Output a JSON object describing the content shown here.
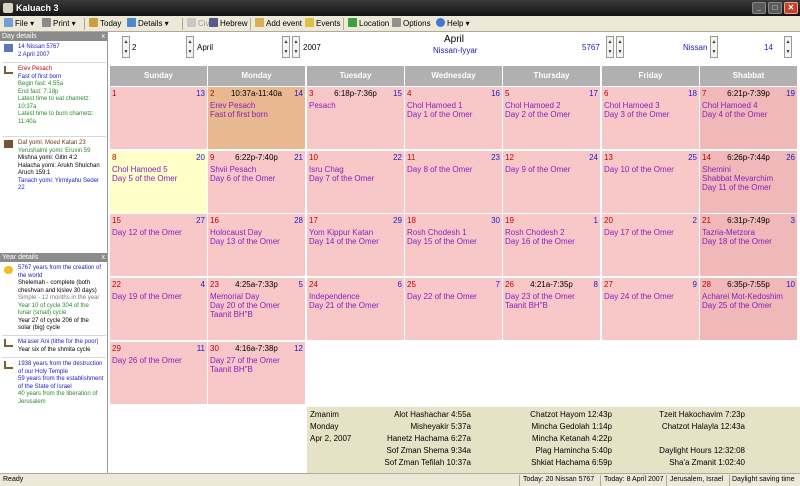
{
  "window": {
    "title": "Kaluach 3"
  },
  "toolbar": {
    "file": "File",
    "print": "Print",
    "today": "Today",
    "details": "Details",
    "civil": "Civil",
    "hebrew": "Hebrew",
    "add_event": "Add event",
    "events": "Events",
    "location": "Location",
    "options": "Options",
    "help": "Help"
  },
  "sidebar": {
    "day_header": "Day details",
    "year_header": "Year details",
    "close_glyph": "x",
    "date_lines": [
      "14 Nissan 5767",
      "2 April 2007"
    ],
    "erev_lines": [
      "Erev Pesach",
      "Fast of first born",
      "Begin fast: 4:55a",
      "End fast: 7:18p",
      "Latest time to eat chametz:",
      "10:37a",
      "Latest time to burn chametz:",
      "11:40a"
    ],
    "daf_lines": [
      "Daf yomi: Moed Katan 23",
      "Yerushalmi yomi: Eruvin 59",
      "Mishna yomi: Gitin 4:2",
      "Halacha yomi: Arukh Shulchan",
      "Aruch 159:1",
      "Tanach yomi: Yirmiyahu Seder",
      "22"
    ],
    "year_lines": [
      "5767 years from the creation of",
      "the world",
      "Shelemah - complete (both",
      "cheshvan and kislev 30 days)",
      "Simple - 12 months in the year",
      "Year 10 of cycle 304 of the",
      "lunar (small) cycle",
      "Year 27 of cycle 206 of the",
      "solar (big) cycle"
    ],
    "maaser_lines": [
      "Ma'aser Ani (tithe for the poor)",
      "Year six of the shmita cycle"
    ],
    "temple_lines": [
      "1938 years from the destruction",
      "of our Holy Temple",
      "59 years from the establishment",
      "of the State of Israel",
      "40 years from the liberation of",
      "Jerusalem"
    ]
  },
  "nav": {
    "day": "2",
    "month": "April",
    "year": "2007",
    "top_month": "April",
    "hebrew_months": "Nissan-Iyyar",
    "hebrew_year": "5767",
    "hebrew_month": "Nissan",
    "hebrew_day": "14"
  },
  "weekdays": [
    "Sunday",
    "Monday",
    "Tuesday",
    "Wednesday",
    "Thursday",
    "Friday",
    "Shabbat"
  ],
  "weeks": [
    [
      {
        "g": "1",
        "h": "13",
        "bg": "#f8c8c8",
        "t": "",
        "ev": []
      },
      {
        "g": "2",
        "h": "14",
        "bg": "#e8b890",
        "t": "10:37a-11:40a",
        "ev": [
          "Erev Pesach",
          "Fast of first born"
        ]
      },
      {
        "g": "3",
        "h": "15",
        "bg": "#f8c8c8",
        "t": "6:18p-7:36p",
        "ev": [
          "Pesach"
        ]
      },
      {
        "g": "4",
        "h": "16",
        "bg": "#f8c8c8",
        "t": "",
        "ev": [
          "Chol Hamoed 1",
          "Day 1 of the Omer"
        ]
      },
      {
        "g": "5",
        "h": "17",
        "bg": "#f8c8c8",
        "t": "",
        "ev": [
          "Chol Hamoed 2",
          "Day 2 of the Omer"
        ]
      },
      {
        "g": "6",
        "h": "18",
        "bg": "#f8c8c8",
        "t": "",
        "ev": [
          "Chol Hamoed 3",
          "Day 3 of the Omer"
        ]
      },
      {
        "g": "7",
        "h": "19",
        "bg": "#f0b8b8",
        "t": "6:21p-7:39p",
        "ev": [
          "Chol Hamoed 4",
          "Day 4 of the Omer"
        ]
      }
    ],
    [
      {
        "g": "8",
        "h": "20",
        "bg": "#ffffc8",
        "t": "",
        "ev": [
          "Chol Hamoed 5",
          "Day 5 of the Omer"
        ]
      },
      {
        "g": "9",
        "h": "21",
        "bg": "#f8c8c8",
        "t": "6:22p-7:40p",
        "ev": [
          "Shvii Pesach",
          "Day 6 of the Omer"
        ]
      },
      {
        "g": "10",
        "h": "22",
        "bg": "#f8c8c8",
        "t": "",
        "ev": [
          "Isru Chag",
          "Day 7 of the Omer"
        ]
      },
      {
        "g": "11",
        "h": "23",
        "bg": "#f8c8c8",
        "t": "",
        "ev": [
          "Day 8 of the Omer"
        ]
      },
      {
        "g": "12",
        "h": "24",
        "bg": "#f8c8c8",
        "t": "",
        "ev": [
          "Day 9 of the Omer"
        ]
      },
      {
        "g": "13",
        "h": "25",
        "bg": "#f8c8c8",
        "t": "",
        "ev": [
          "Day 10 of the Omer"
        ]
      },
      {
        "g": "14",
        "h": "26",
        "bg": "#f0b8b8",
        "t": "6:26p-7:44p",
        "ev": [
          "Shemini",
          "Shabbat Mevarchim",
          "Day 11 of the Omer"
        ]
      }
    ],
    [
      {
        "g": "15",
        "h": "27",
        "bg": "#f8c8c8",
        "t": "",
        "ev": [
          "Day 12 of the Omer"
        ]
      },
      {
        "g": "16",
        "h": "28",
        "bg": "#f8c8c8",
        "t": "",
        "ev": [
          "Holocaust Day",
          "Day 13 of the Omer"
        ]
      },
      {
        "g": "17",
        "h": "29",
        "bg": "#f8c8c8",
        "t": "",
        "ev": [
          "Yom Kippur Katan",
          "Day 14 of the Omer"
        ]
      },
      {
        "g": "18",
        "h": "30",
        "bg": "#f8c8c8",
        "t": "",
        "ev": [
          "Rosh Chodesh 1",
          "Day 15 of the Omer"
        ]
      },
      {
        "g": "19",
        "h": "1",
        "bg": "#f8c8c8",
        "t": "",
        "ev": [
          "Rosh Chodesh 2",
          "Day 16 of the Omer"
        ]
      },
      {
        "g": "20",
        "h": "2",
        "bg": "#f8c8c8",
        "t": "",
        "ev": [
          "Day 17 of the Omer"
        ]
      },
      {
        "g": "21",
        "h": "3",
        "bg": "#f0b8b8",
        "t": "6:31p-7:49p",
        "ev": [
          "Tazria-Metzora",
          "Day 18 of the Omer"
        ]
      }
    ],
    [
      {
        "g": "22",
        "h": "4",
        "bg": "#f8c8c8",
        "t": "",
        "ev": [
          "Day 19 of the Omer"
        ]
      },
      {
        "g": "23",
        "h": "5",
        "bg": "#f8c8c8",
        "t": "4:25a-7:33p",
        "ev": [
          "Memorial Day",
          "Day 20 of the Omer",
          "Taanit BH\"B"
        ]
      },
      {
        "g": "24",
        "h": "6",
        "bg": "#f8c8c8",
        "t": "",
        "ev": [
          "Independence",
          "Day 21 of the Omer"
        ]
      },
      {
        "g": "25",
        "h": "7",
        "bg": "#f8c8c8",
        "t": "",
        "ev": [
          "Day 22 of the Omer"
        ]
      },
      {
        "g": "26",
        "h": "8",
        "bg": "#f8c8c8",
        "t": "4:21a-7:35p",
        "ev": [
          "Day 23 of the Omer",
          "Taanit BH\"B"
        ]
      },
      {
        "g": "27",
        "h": "9",
        "bg": "#f8c8c8",
        "t": "",
        "ev": [
          "Day 24 of the Omer"
        ]
      },
      {
        "g": "28",
        "h": "10",
        "bg": "#f0b8b8",
        "t": "6:35p-7:55p",
        "ev": [
          "Acharei Mot-Kedoshim",
          "Day 25 of the Omer"
        ]
      }
    ],
    [
      {
        "g": "29",
        "h": "11",
        "bg": "#f8c8c8",
        "t": "",
        "ev": [
          "Day 26 of the Omer"
        ]
      },
      {
        "g": "30",
        "h": "12",
        "bg": "#f8c8c8",
        "t": "4:16a-7:38p",
        "ev": [
          "Day 27 of the Omer",
          "Taanit BH\"B"
        ]
      }
    ]
  ],
  "zmanim": {
    "title": "Zmanim",
    "day": "Monday",
    "date": "Apr  2, 2007",
    "items": [
      "Alot Hashachar 4:55a",
      "Misheyakir 5:37a",
      "Hanetz Hachama 6:27a",
      "Sof Zman Shema 9:34a",
      "Sof Zman Tefilah 10:37a",
      "Chatzot Hayom 12:43p",
      "Mincha Gedolah 1:14p",
      "Mincha Ketanah 4:22p",
      "Plag Hamincha 5:40p",
      "Shkiat Hachama 6:59p",
      "Tzeit Hakochavim 7:23p",
      "Chatzot Halayla 12:43a",
      "",
      "Daylight Hours 12:32:08",
      "Sha'a Zmanit  1:02:40"
    ]
  },
  "status": {
    "ready": "Ready",
    "today_hebrew": "Today: 20 Nissan 5767",
    "today_civil": "Today: 8 April 2007",
    "location": "Jerusalem, Israel",
    "dst": "Daylight saving time"
  },
  "colors": {
    "weekend": "#f0b8b8",
    "weekday": "#f8c8c8",
    "today": "#ffffc8",
    "selected": "#e8b890",
    "event": "#8a1ec0",
    "hebrew_date": "#1a1acc",
    "civil_date": "#c00000"
  }
}
